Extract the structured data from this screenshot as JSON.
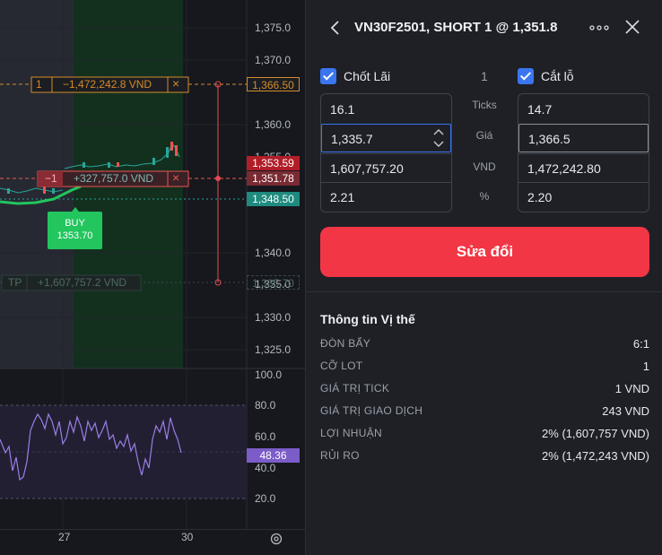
{
  "chart": {
    "price_axis": [
      "1,375.0",
      "1,370.0",
      "1,360.0",
      "1,355.0",
      "1,340.0",
      "1,335.0",
      "1,330.0",
      "1,325.0"
    ],
    "rsi_axis": [
      "100.0",
      "80.0",
      "60.0",
      "40.0",
      "20.0"
    ],
    "date_axis": [
      "27",
      "30"
    ],
    "tp_line": {
      "qty": "1",
      "value": "−1,472,242.8 VND",
      "close": "×",
      "price": "1,366.50"
    },
    "position_line": {
      "qty": "−1",
      "value": "+327,757.0 VND",
      "close": "×",
      "price": "1,351.78"
    },
    "sl_line": {
      "label": "TP",
      "value": "+1,607,757.2 VND",
      "price": "1,335.70"
    },
    "last_price": "1,353.59",
    "bid_price": "1,348.50",
    "buy_marker": {
      "label": "BUY",
      "price": "1353.70"
    },
    "rsi_value": "48.36",
    "colors": {
      "up": "#26a69a",
      "down": "#ef5350",
      "rsi": "#9b7ee6",
      "buy": "#22c55e"
    }
  },
  "panel": {
    "title": "VN30F2501, SHORT 1 @ 1,351.8",
    "back_icon": "chevron-left-icon",
    "more_icon": "more-icon",
    "close_icon": "close-icon",
    "take_profit": {
      "label": "Chốt Lãi",
      "checked": true,
      "ticks": "16.1",
      "price": "1,335.7",
      "vnd": "1,607,757.20",
      "pct": "2.21"
    },
    "stop_loss": {
      "label": "Cắt lỗ",
      "checked": true,
      "ticks": "14.7",
      "price": "1,366.5",
      "vnd": "1,472,242.80",
      "pct": "2.20"
    },
    "qty": "1",
    "row_labels": {
      "ticks": "Ticks",
      "price": "Giá",
      "vnd": "VND",
      "pct": "%"
    },
    "save_label": "Sửa đổi",
    "info_title": "Thông tin Vị thế",
    "info": [
      {
        "k": "ĐÒN BẨY",
        "v": "6:1"
      },
      {
        "k": "CỠ LOT",
        "v": "1"
      },
      {
        "k": "GIÁ TRỊ TICK",
        "v": "1 VND"
      },
      {
        "k": "GIÁ TRỊ GIAO DỊCH",
        "v": "243 VND"
      },
      {
        "k": "LỢI NHUẬN",
        "v": "2% (1,607,757 VND)"
      },
      {
        "k": "RỦI RO",
        "v": "2% (1,472,243 VND)"
      }
    ]
  }
}
